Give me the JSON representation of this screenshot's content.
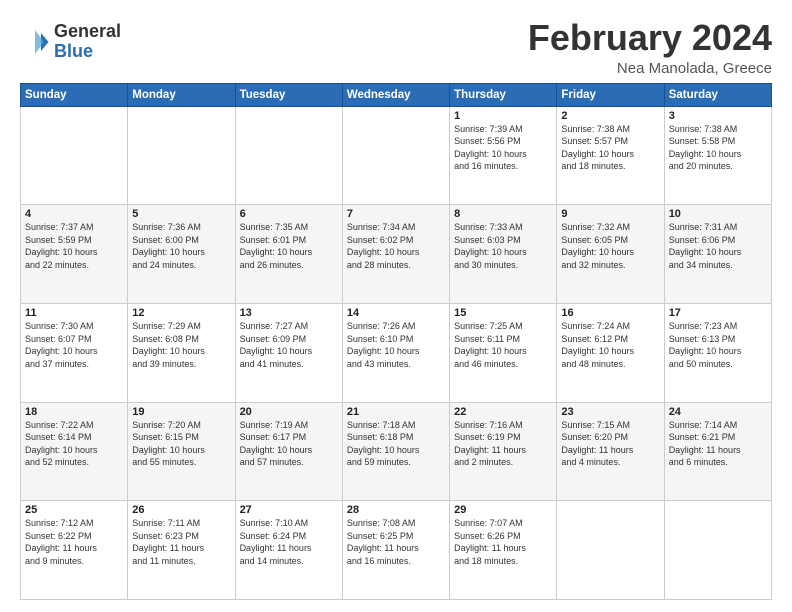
{
  "logo": {
    "line1": "General",
    "line2": "Blue"
  },
  "title": "February 2024",
  "subtitle": "Nea Manolada, Greece",
  "days_of_week": [
    "Sunday",
    "Monday",
    "Tuesday",
    "Wednesday",
    "Thursday",
    "Friday",
    "Saturday"
  ],
  "weeks": [
    [
      {
        "day": "",
        "info": ""
      },
      {
        "day": "",
        "info": ""
      },
      {
        "day": "",
        "info": ""
      },
      {
        "day": "",
        "info": ""
      },
      {
        "day": "1",
        "info": "Sunrise: 7:39 AM\nSunset: 5:56 PM\nDaylight: 10 hours\nand 16 minutes."
      },
      {
        "day": "2",
        "info": "Sunrise: 7:38 AM\nSunset: 5:57 PM\nDaylight: 10 hours\nand 18 minutes."
      },
      {
        "day": "3",
        "info": "Sunrise: 7:38 AM\nSunset: 5:58 PM\nDaylight: 10 hours\nand 20 minutes."
      }
    ],
    [
      {
        "day": "4",
        "info": "Sunrise: 7:37 AM\nSunset: 5:59 PM\nDaylight: 10 hours\nand 22 minutes."
      },
      {
        "day": "5",
        "info": "Sunrise: 7:36 AM\nSunset: 6:00 PM\nDaylight: 10 hours\nand 24 minutes."
      },
      {
        "day": "6",
        "info": "Sunrise: 7:35 AM\nSunset: 6:01 PM\nDaylight: 10 hours\nand 26 minutes."
      },
      {
        "day": "7",
        "info": "Sunrise: 7:34 AM\nSunset: 6:02 PM\nDaylight: 10 hours\nand 28 minutes."
      },
      {
        "day": "8",
        "info": "Sunrise: 7:33 AM\nSunset: 6:03 PM\nDaylight: 10 hours\nand 30 minutes."
      },
      {
        "day": "9",
        "info": "Sunrise: 7:32 AM\nSunset: 6:05 PM\nDaylight: 10 hours\nand 32 minutes."
      },
      {
        "day": "10",
        "info": "Sunrise: 7:31 AM\nSunset: 6:06 PM\nDaylight: 10 hours\nand 34 minutes."
      }
    ],
    [
      {
        "day": "11",
        "info": "Sunrise: 7:30 AM\nSunset: 6:07 PM\nDaylight: 10 hours\nand 37 minutes."
      },
      {
        "day": "12",
        "info": "Sunrise: 7:29 AM\nSunset: 6:08 PM\nDaylight: 10 hours\nand 39 minutes."
      },
      {
        "day": "13",
        "info": "Sunrise: 7:27 AM\nSunset: 6:09 PM\nDaylight: 10 hours\nand 41 minutes."
      },
      {
        "day": "14",
        "info": "Sunrise: 7:26 AM\nSunset: 6:10 PM\nDaylight: 10 hours\nand 43 minutes."
      },
      {
        "day": "15",
        "info": "Sunrise: 7:25 AM\nSunset: 6:11 PM\nDaylight: 10 hours\nand 46 minutes."
      },
      {
        "day": "16",
        "info": "Sunrise: 7:24 AM\nSunset: 6:12 PM\nDaylight: 10 hours\nand 48 minutes."
      },
      {
        "day": "17",
        "info": "Sunrise: 7:23 AM\nSunset: 6:13 PM\nDaylight: 10 hours\nand 50 minutes."
      }
    ],
    [
      {
        "day": "18",
        "info": "Sunrise: 7:22 AM\nSunset: 6:14 PM\nDaylight: 10 hours\nand 52 minutes."
      },
      {
        "day": "19",
        "info": "Sunrise: 7:20 AM\nSunset: 6:15 PM\nDaylight: 10 hours\nand 55 minutes."
      },
      {
        "day": "20",
        "info": "Sunrise: 7:19 AM\nSunset: 6:17 PM\nDaylight: 10 hours\nand 57 minutes."
      },
      {
        "day": "21",
        "info": "Sunrise: 7:18 AM\nSunset: 6:18 PM\nDaylight: 10 hours\nand 59 minutes."
      },
      {
        "day": "22",
        "info": "Sunrise: 7:16 AM\nSunset: 6:19 PM\nDaylight: 11 hours\nand 2 minutes."
      },
      {
        "day": "23",
        "info": "Sunrise: 7:15 AM\nSunset: 6:20 PM\nDaylight: 11 hours\nand 4 minutes."
      },
      {
        "day": "24",
        "info": "Sunrise: 7:14 AM\nSunset: 6:21 PM\nDaylight: 11 hours\nand 6 minutes."
      }
    ],
    [
      {
        "day": "25",
        "info": "Sunrise: 7:12 AM\nSunset: 6:22 PM\nDaylight: 11 hours\nand 9 minutes."
      },
      {
        "day": "26",
        "info": "Sunrise: 7:11 AM\nSunset: 6:23 PM\nDaylight: 11 hours\nand 11 minutes."
      },
      {
        "day": "27",
        "info": "Sunrise: 7:10 AM\nSunset: 6:24 PM\nDaylight: 11 hours\nand 14 minutes."
      },
      {
        "day": "28",
        "info": "Sunrise: 7:08 AM\nSunset: 6:25 PM\nDaylight: 11 hours\nand 16 minutes."
      },
      {
        "day": "29",
        "info": "Sunrise: 7:07 AM\nSunset: 6:26 PM\nDaylight: 11 hours\nand 18 minutes."
      },
      {
        "day": "",
        "info": ""
      },
      {
        "day": "",
        "info": ""
      }
    ]
  ]
}
